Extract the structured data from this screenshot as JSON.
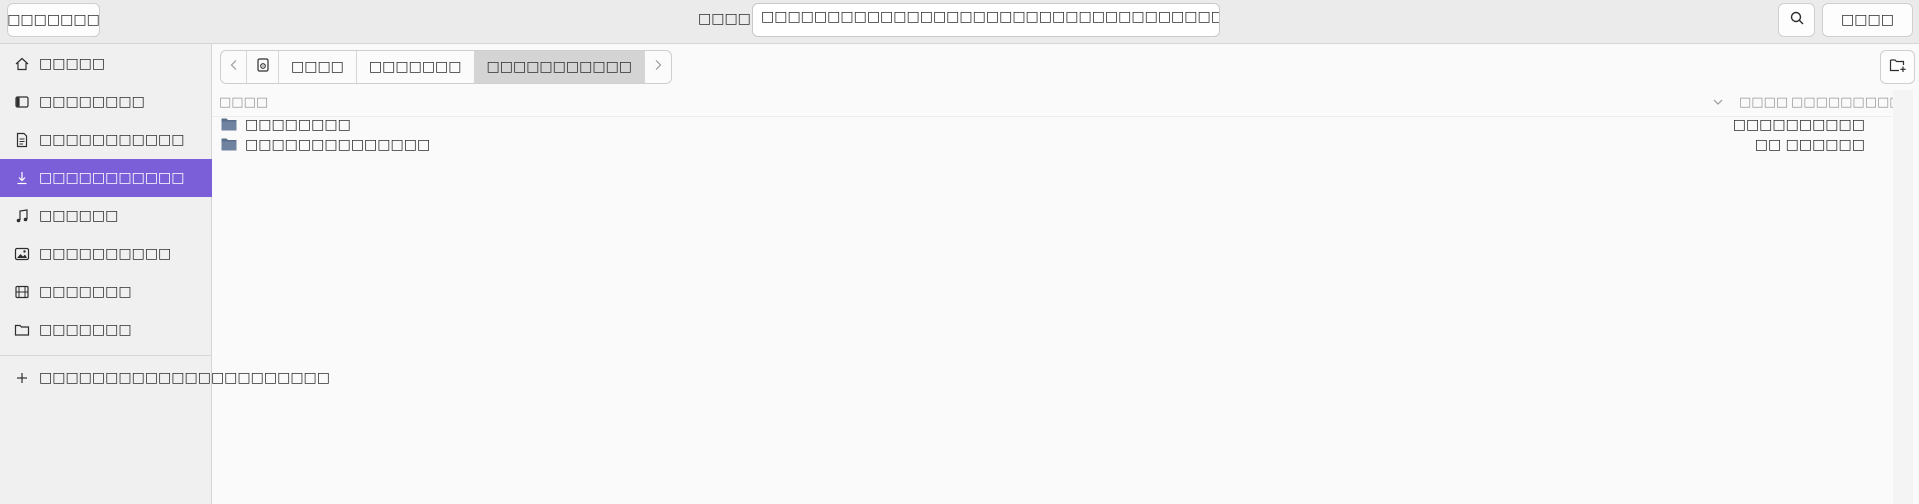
{
  "header": {
    "cancel_label": "□□□□□□□",
    "name_label": "□□□□",
    "name_value": "□□□□□□□□□□□□□□□□□□□□□□□□□□□□□□□□□□□□□□□□□□□□□□□□□□□□□□□□",
    "search_icon": "search-icon",
    "open_label": "□□□□"
  },
  "sidebar": {
    "items": [
      {
        "label": "□□□□□",
        "icon": "home-icon"
      },
      {
        "label": "□□□□□□□□",
        "icon": "desktop-icon"
      },
      {
        "label": "□□□□□□□□□□□",
        "icon": "document-icon"
      },
      {
        "label": "□□□□□□□□□□□",
        "icon": "download-icon",
        "active": true
      },
      {
        "label": "□□□□□□",
        "icon": "music-icon"
      },
      {
        "label": "□□□□□□□□□□",
        "icon": "picture-icon"
      },
      {
        "label": "□□□□□□□",
        "icon": "video-icon"
      },
      {
        "label": "□□□□□□□",
        "icon": "folder-icon"
      }
    ],
    "other_locations": {
      "label": "□□□□□□□□□□□□□□□□□□□□□□",
      "icon": "plus-icon"
    }
  },
  "pathbar": {
    "crumbs": [
      "□□□□",
      "□□□□□□□",
      "□□□□□□□□□□□"
    ],
    "current_index": 2
  },
  "filelist": {
    "columns": {
      "name": "□□□□",
      "size": "□□□□",
      "modified": "□□□□□□□□□□"
    },
    "rows": [
      {
        "name": "□□□□□□□□",
        "modified": "□□□□□□□□□□"
      },
      {
        "name": "□□□□□□□□□□□□□□",
        "modified": "□□ □□□□□□"
      }
    ]
  },
  "colors": {
    "accent": "#7a5fd8",
    "folder": "#5a6f8a"
  }
}
